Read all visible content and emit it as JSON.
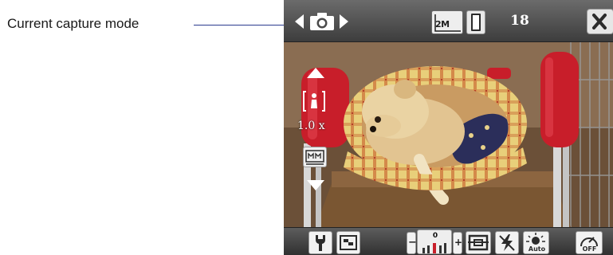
{
  "callout": {
    "label": "Current capture mode"
  },
  "topbar": {
    "resolution_label": "2M",
    "shots_remaining": "18"
  },
  "zoom": {
    "level_label": "1.0 x"
  },
  "bottombar": {
    "brightness_level": "0",
    "brightness_minus": "−",
    "brightness_plus": "+",
    "white_balance_label": "Auto",
    "timer_label": "OFF"
  },
  "colors": {
    "callout_line": "#2b3a8f",
    "toolbar_bg": "#4a4a4a",
    "button_face": "#f2f2f2",
    "cushion": "#c81e2a"
  }
}
